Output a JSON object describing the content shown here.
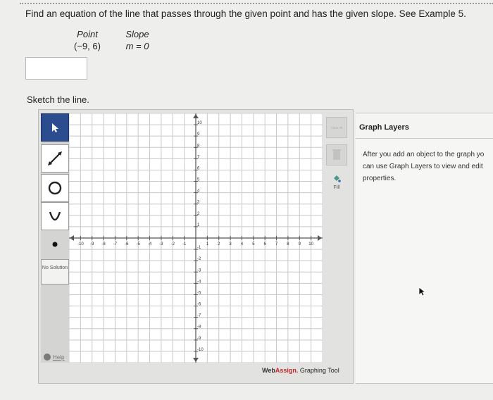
{
  "question": "Find an equation of the line that passes through the given point and has the given slope. See Example 5.",
  "given": {
    "point_header": "Point",
    "point_value": "(−9, 6)",
    "slope_header": "Slope",
    "slope_value": "m = 0"
  },
  "answer_value": "",
  "sketch_label": "Sketch the line.",
  "toolbar": {
    "tools": [
      "pointer-icon",
      "line-tool-icon",
      "circle-tool-icon",
      "parabola-tool-icon",
      "point-tool-icon"
    ],
    "no_solution_label": "No Solution",
    "help_label": "Help"
  },
  "right_tools": {
    "delete_label": "Clear All",
    "fill_label": "Fill"
  },
  "graph": {
    "x_ticks": [
      "-10",
      "-9",
      "-8",
      "-7",
      "-6",
      "-5",
      "-4",
      "-3",
      "-2",
      "-1",
      "1",
      "2",
      "3",
      "4",
      "5",
      "6",
      "7",
      "8",
      "9",
      "10"
    ],
    "y_ticks": [
      "10",
      "9",
      "8",
      "7",
      "6",
      "5",
      "4",
      "3",
      "2",
      "1",
      "-1",
      "-2",
      "-3",
      "-4",
      "-5",
      "-6",
      "-7",
      "-8",
      "-9",
      "-10"
    ],
    "x_range": [
      -11,
      11
    ],
    "y_range": [
      -11,
      11
    ]
  },
  "layers": {
    "title": "Graph Layers",
    "help_text": "After you add an object to the graph you can use Graph Layers to view and edit its properties.",
    "help_lines": [
      "After you add an object to the graph yo",
      "can use Graph Layers to view and edit",
      "properties."
    ]
  },
  "brand": {
    "web": "Web",
    "assign": "Assign.",
    "tail": " Graphing Tool"
  },
  "colors": {
    "active_tool": "#2b4d8f",
    "brand_red": "#c0282d",
    "grid": "#c8c8c8"
  }
}
